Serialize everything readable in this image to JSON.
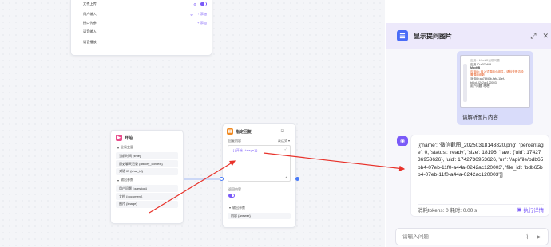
{
  "top_node": {
    "rows": [
      {
        "label": "文件上传",
        "right_text": "",
        "toggle": true
      },
      {
        "label": "用户输入",
        "right_text": "+ 添加"
      },
      {
        "label": "接口传参",
        "right_text": "+ 添加"
      },
      {
        "label": "语音输入",
        "right_text": ""
      },
      {
        "label": "语音播放",
        "right_text": ""
      }
    ]
  },
  "start_node": {
    "title": "开始",
    "global_section": "全局变量",
    "global_vars": [
      "当前时间 {time}",
      "历史聊天记录 {history_context}",
      "对话 ID {chat_id}"
    ],
    "output_section": "输出参数",
    "output_vars": [
      "用户问题 {question}",
      "文档 {document}",
      "图片 {image}"
    ]
  },
  "reply_node": {
    "title": "指定回复",
    "content_label": "回复内容",
    "content_mode": "表达式",
    "content_expr": "{{开始.image}}",
    "return_label": "返回内容",
    "output_section": "输出参数",
    "output_var": "内容 {answer}"
  },
  "panel": {
    "title": "显示提问图片",
    "user_message": "请解析图片内容",
    "screenshot_lines": [
      "应用：MaxKB出现问题 ...",
      "应用 ID:a07bf4ff...",
      "MaxKB",
      "应用ID: 嵌入式调用小组件，请检查是否设置调用参数",
      "对话ID:aa78f40b-fafd-11ef-",
      "b6cd-0242ac120003",
      "用户问题: 嗯嗯"
    ],
    "answer_text": "[{'name': '微信截图_20250318143820.png', 'percentage': 0, 'status': 'ready', 'size': 18196, 'raw': {'uid': 1742736953626}, 'uid': 1742736953626, 'url': '/api/file/bdb65bb4-07eb-11f0-a44a-0242ac120003', 'file_id': 'bdb65bb4-07eb-11f0-a44a-0242ac120003'}]",
    "tokens_text": "消耗tokens: 0  耗时: 0.00 s",
    "detail_label": "执行详情",
    "input_placeholder": "请输入问题"
  },
  "colors": {
    "accent": "#7a5af8",
    "brand_blue": "#4a6cf7",
    "arrow": "#e8322a"
  },
  "icons": {
    "start": "play-icon",
    "reply": "reply-icon",
    "panel_logo": "chat-logo-icon",
    "bot": "bot-avatar-icon",
    "send": "send-icon",
    "attach": "paperclip-icon"
  }
}
